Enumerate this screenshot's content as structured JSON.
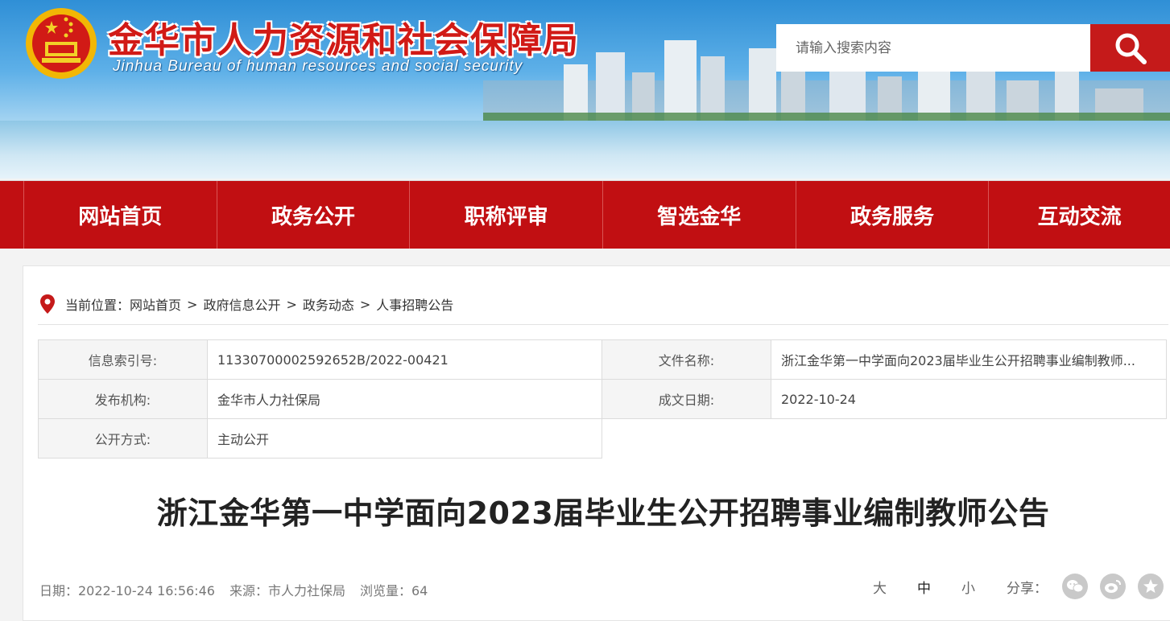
{
  "header": {
    "title_cn": "金华市人力资源和社会保障局",
    "title_en": "Jinhua Bureau of human resources and social security",
    "search_placeholder": "请输入搜索内容",
    "search_icon": "search-icon",
    "colors": {
      "brand_red": "#c10f12",
      "sky": "#5eb0e8"
    }
  },
  "nav": [
    "网站首页",
    "政务公开",
    "职称评审",
    "智选金华",
    "政务服务",
    "互动交流"
  ],
  "breadcrumb": {
    "prefix": "当前位置：",
    "items": [
      "网站首页",
      "政府信息公开",
      "政务动态",
      "人事招聘公告"
    ],
    "separator": ">"
  },
  "meta": {
    "index_label": "信息索引号:",
    "index_value": "11330700002592652B/2022-00421",
    "filename_label": "文件名称:",
    "filename_value": "浙江金华第一中学面向2023届毕业生公开招聘事业编制教师...",
    "publisher_label": "发布机构:",
    "publisher_value": "金华市人力社保局",
    "date_label": "成文日期:",
    "date_value": "2022-10-24",
    "mode_label": "公开方式:",
    "mode_value": "主动公开"
  },
  "article": {
    "title": "浙江金华第一中学面向2023届毕业生公开招聘事业编制教师公告",
    "date": "日期：2022-10-24 16:56:46",
    "source": "来源：市人力社保局",
    "views": "浏览量：64"
  },
  "tools": {
    "size_large": "大",
    "size_medium": "中",
    "size_small": "小",
    "share_label": "分享：",
    "icons": [
      "wechat-icon",
      "weibo-icon",
      "qzone-icon"
    ]
  }
}
